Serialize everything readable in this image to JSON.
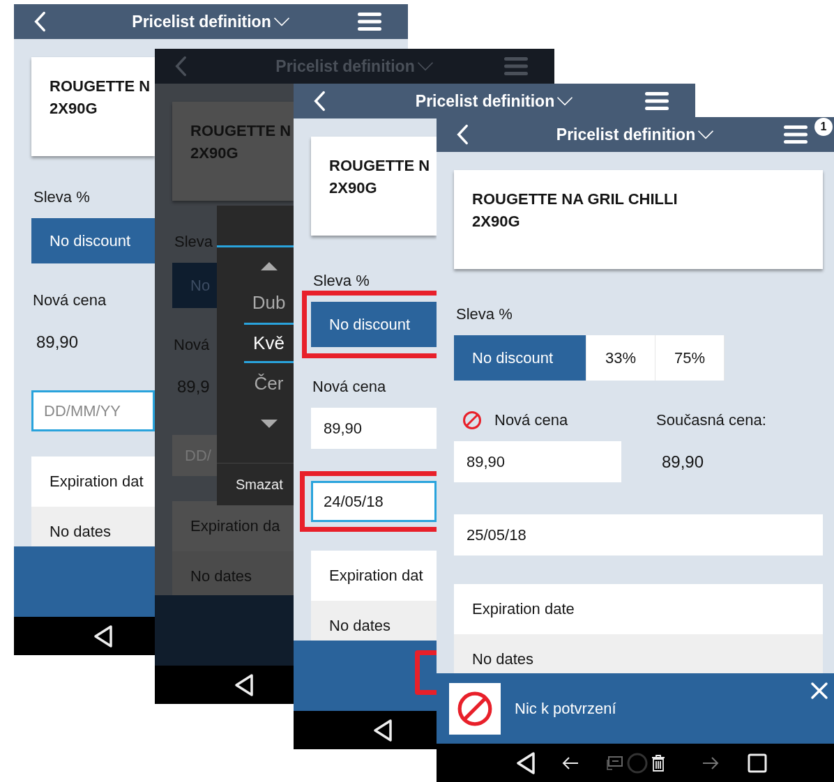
{
  "screens": [
    {
      "dimmed": false,
      "title": "Pricelist definition",
      "product_lines": [
        "ROUGETTE N",
        "2X90G"
      ],
      "discount_label": "Sleva %",
      "discount_options": [
        {
          "label": "No discount",
          "selected": true
        }
      ],
      "price_label": "Nová cena",
      "price": {
        "kind": "text",
        "value": "89,90"
      },
      "date_field": {
        "placeholder": "DD/MM/YY",
        "focused": true
      },
      "expiration": {
        "title": "Expiration dat",
        "empty_text": "No dates"
      }
    },
    {
      "dimmed": true,
      "title": "Pricelist definition",
      "product_lines": [
        "ROUGETTE N",
        "2X90G"
      ],
      "discount_label": "Sleva",
      "discount_options": [
        {
          "label": "No",
          "selected": true
        }
      ],
      "price_label": "Nová",
      "price": {
        "kind": "text",
        "value": "89,9"
      },
      "date_field": {
        "placeholder": "DD/",
        "focused": false
      },
      "expiration": {
        "title": "Expiration da",
        "empty_text": "No dates"
      },
      "picker": {
        "months": [
          {
            "label": "Dub",
            "selected": false
          },
          {
            "label": "Kvě",
            "selected": true
          },
          {
            "label": "Čer",
            "selected": false
          }
        ],
        "clear_button": "Smazat"
      }
    },
    {
      "dimmed": false,
      "title": "Pricelist definition",
      "product_lines": [
        "ROUGETTE N",
        "2X90G"
      ],
      "discount_label": "Sleva %",
      "discount_highlighted": true,
      "discount_options": [
        {
          "label": "No discount",
          "selected": true
        }
      ],
      "price_label": "Nová cena",
      "price": {
        "kind": "field",
        "value": "89,90"
      },
      "date_field": {
        "value": "24/05/18",
        "focused": true,
        "highlighted": true
      },
      "expiration": {
        "title": "Expiration dat",
        "empty_text": "No dates"
      },
      "bottom_bar": {
        "highlighted": true
      }
    },
    {
      "dimmed": false,
      "title": "Pricelist definition",
      "menu_badge": "1",
      "product_lines": [
        "ROUGETTE NA GRIL CHILLI",
        "2X90G"
      ],
      "discount_label": "Sleva %",
      "discount_options": [
        {
          "label": "No discount",
          "selected": true
        },
        {
          "label": "33%",
          "selected": false
        },
        {
          "label": "75%",
          "selected": false
        }
      ],
      "price_label": "Nová cena",
      "price_error": true,
      "price": {
        "kind": "field",
        "value": "89,90"
      },
      "current_price": {
        "label": "Současná cena:",
        "value": "89,90"
      },
      "date_field": {
        "value": "25/05/18",
        "focused": false
      },
      "expiration": {
        "title": "Expiration date",
        "empty_text": "No dates"
      },
      "toast": {
        "message": "Nic k potvrzení"
      }
    }
  ]
}
